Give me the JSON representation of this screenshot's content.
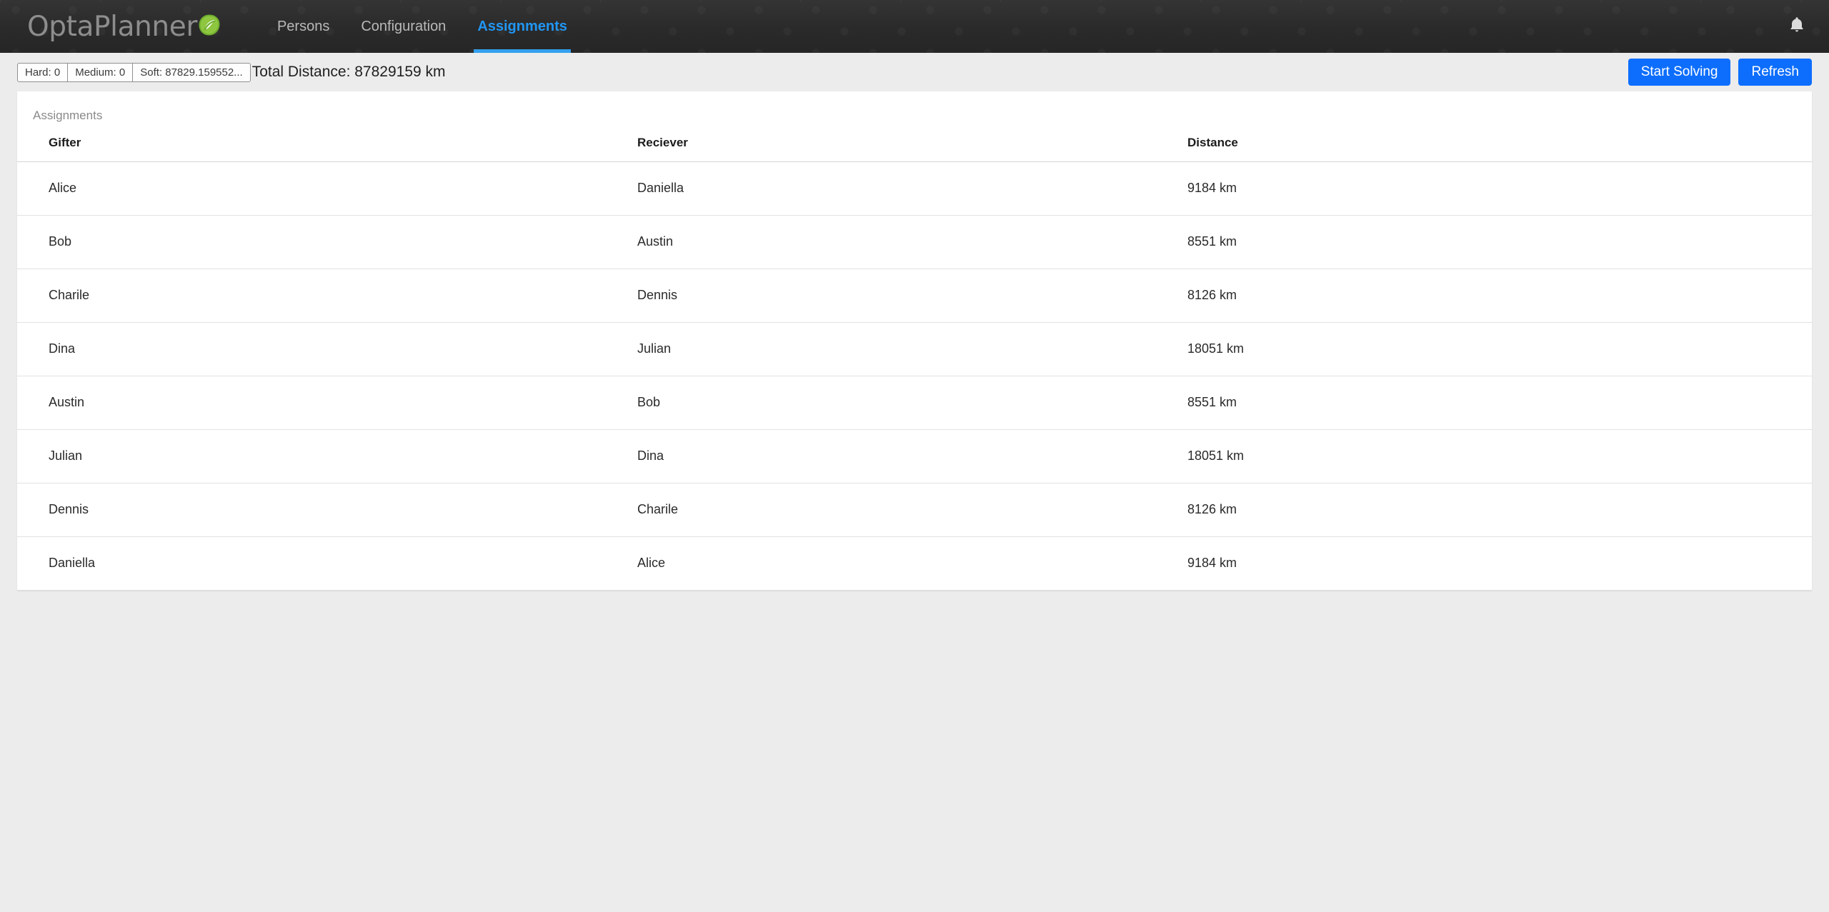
{
  "navbar": {
    "brand": "OptaPlanner",
    "brand_logo_icon": "optaplanner-leaf-logo",
    "links": [
      {
        "label": "Persons",
        "active": false
      },
      {
        "label": "Configuration",
        "active": false
      },
      {
        "label": "Assignments",
        "active": true
      }
    ],
    "notification_icon": "bell-icon",
    "accent_color": "#33a0f0",
    "background_color": "#2b2b2b"
  },
  "toolbar": {
    "score_chips": [
      {
        "label": "Hard: 0"
      },
      {
        "label": "Medium: 0"
      },
      {
        "label": "Soft: 87829.159552..."
      }
    ],
    "total_distance": "Total Distance: 87829159 km",
    "start_solving_label": "Start Solving",
    "refresh_label": "Refresh",
    "button_color": "#0d6efd"
  },
  "table": {
    "caption": "Assignments",
    "columns": [
      "Gifter",
      "Reciever",
      "Distance"
    ],
    "rows": [
      {
        "gifter": "Alice",
        "reciever": "Daniella",
        "distance": "9184 km"
      },
      {
        "gifter": "Bob",
        "reciever": "Austin",
        "distance": "8551 km"
      },
      {
        "gifter": "Charile",
        "reciever": "Dennis",
        "distance": "8126 km"
      },
      {
        "gifter": "Dina",
        "reciever": "Julian",
        "distance": "18051 km"
      },
      {
        "gifter": "Austin",
        "reciever": "Bob",
        "distance": "8551 km"
      },
      {
        "gifter": "Julian",
        "reciever": "Dina",
        "distance": "18051 km"
      },
      {
        "gifter": "Dennis",
        "reciever": "Charile",
        "distance": "8126 km"
      },
      {
        "gifter": "Daniella",
        "reciever": "Alice",
        "distance": "9184 km"
      }
    ]
  }
}
